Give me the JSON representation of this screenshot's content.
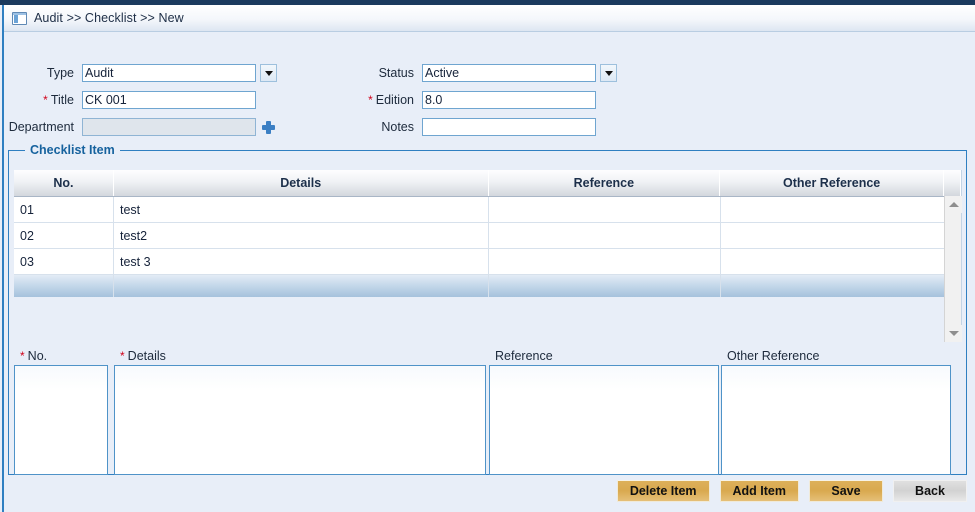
{
  "breadcrumb": {
    "icon": "window-panel-icon",
    "text": "Audit >> Checklist >> New"
  },
  "form": {
    "type": {
      "label": "Type",
      "value": "Audit",
      "dropdown_icon": "chevron-down-icon"
    },
    "title": {
      "label": "Title",
      "required_marker": "*",
      "value": "CK 001"
    },
    "department": {
      "label": "Department",
      "value": "",
      "placeholder": "",
      "add_icon": "plus-icon"
    },
    "status": {
      "label": "Status",
      "value": "Active",
      "dropdown_icon": "chevron-down-icon"
    },
    "edition": {
      "label": "Edition",
      "required_marker": "*",
      "value": "8.0"
    },
    "notes": {
      "label": "Notes",
      "value": "",
      "placeholder": ""
    }
  },
  "checklist": {
    "legend": "Checklist Item",
    "columns": [
      "No.",
      "Details",
      "Reference",
      "Other Reference"
    ],
    "rows": [
      {
        "no": "01",
        "details": "test",
        "reference": "",
        "other_reference": ""
      },
      {
        "no": "02",
        "details": "test2",
        "reference": "",
        "other_reference": ""
      },
      {
        "no": "03",
        "details": "test 3",
        "reference": "",
        "other_reference": ""
      },
      {
        "no": "",
        "details": "",
        "reference": "",
        "other_reference": "",
        "selected": true
      }
    ],
    "scrollbar": {
      "up_icon": "triangle-up-icon",
      "down_icon": "triangle-down-icon"
    }
  },
  "entry": {
    "no": {
      "label": "No.",
      "required_marker": "*",
      "value": ""
    },
    "details": {
      "label": "Details",
      "required_marker": "*",
      "value": ""
    },
    "reference": {
      "label": "Reference",
      "value": ""
    },
    "other_reference": {
      "label": "Other Reference",
      "value": ""
    }
  },
  "buttons": {
    "delete_item": "Delete Item",
    "add_item": "Add Item",
    "save": "Save",
    "back": "Back"
  },
  "colors": {
    "page_background": "#e8eef8",
    "top_strip": "#1b3a5e",
    "accent_blue": "#2f7fc1",
    "legend_blue": "#16629e",
    "required_red": "#d0021b",
    "button_gold": "#d9a94f",
    "button_grey": "#d2d2d2",
    "row_selected": "#9dbcd9"
  }
}
